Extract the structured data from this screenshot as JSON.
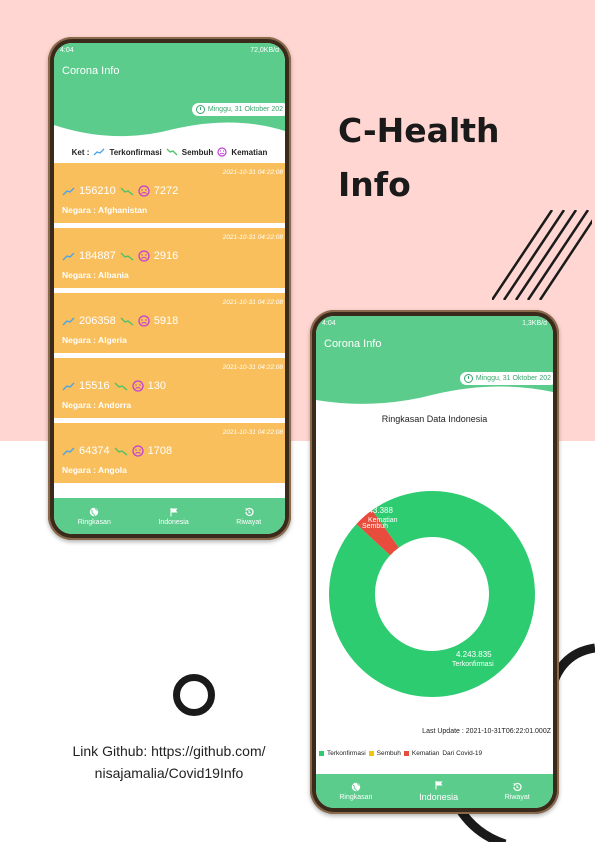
{
  "poster": {
    "title_line1": "C-Health",
    "title_line2": "Info",
    "link_line1": "Link Github: https://github.com/",
    "link_line2": "nisajamalia/Covid19Info",
    "colors": {
      "background_top": "#ffd6d1",
      "accent_green": "#5ccc8c",
      "card_orange": "#f8bf5c"
    }
  },
  "phone1": {
    "status_left": "4:04",
    "status_right": "72,0KB/d",
    "app_title": "Corona Info",
    "date": "Minggu, 31 Oktober 202",
    "legend": {
      "prefix": "Ket :",
      "confirmed": "Terkonfirmasi",
      "recovered": "Sembuh",
      "deaths": "Kematian"
    },
    "cards": [
      {
        "timestamp": "2021-10-31 04:22:08",
        "confirmed": "156210",
        "deaths": "7272",
        "country": "Negara : Afghanistan"
      },
      {
        "timestamp": "2021-10-31 04:22:08",
        "confirmed": "184887",
        "deaths": "2916",
        "country": "Negara : Albania"
      },
      {
        "timestamp": "2021-10-31 04:22:08",
        "confirmed": "206358",
        "deaths": "5918",
        "country": "Negara : Algeria"
      },
      {
        "timestamp": "2021-10-31 04:22:08",
        "confirmed": "15516",
        "deaths": "130",
        "country": "Negara : Andorra"
      },
      {
        "timestamp": "2021-10-31 04:22:08",
        "confirmed": "64374",
        "deaths": "1708",
        "country": "Negara : Angola"
      }
    ],
    "nav": [
      {
        "label": "Ringkasan",
        "icon": "globe-icon"
      },
      {
        "label": "Indonesia",
        "icon": "flag-icon"
      },
      {
        "label": "Riwayat",
        "icon": "history-icon"
      }
    ]
  },
  "phone2": {
    "status_left": "4:04",
    "status_right": "1,3KB/d",
    "app_title": "Corona Info",
    "date": "Minggu, 31 Oktober 202",
    "summary_title": "Ringkasan Data Indonesia",
    "last_update": "Last Update : 2021-10-31T06:22:01.000Z",
    "legend": [
      "Terkonfirmasi",
      "Sembuh",
      "Kematian",
      "Dari Covid-19"
    ],
    "nav": [
      {
        "label": "Ringkasan",
        "icon": "globe-icon"
      },
      {
        "label": "Indonesia",
        "icon": "flag-icon"
      },
      {
        "label": "Riwayat",
        "icon": "history-icon"
      }
    ]
  },
  "chart_data": {
    "type": "pie",
    "title": "Ringkasan Data Indonesia",
    "categories": [
      "Terkonfirmasi",
      "Sembuh",
      "Kematian"
    ],
    "values": [
      4243835,
      0,
      143388
    ],
    "value_labels": [
      "4.243.835",
      "",
      "143.388"
    ],
    "slice_labels": [
      "Terkonfirmasi",
      "Sembuh",
      "Kematian"
    ],
    "colors": [
      "#2ecc71",
      "#f1c40f",
      "#e74c3c"
    ],
    "legend_position": "bottom-left"
  }
}
